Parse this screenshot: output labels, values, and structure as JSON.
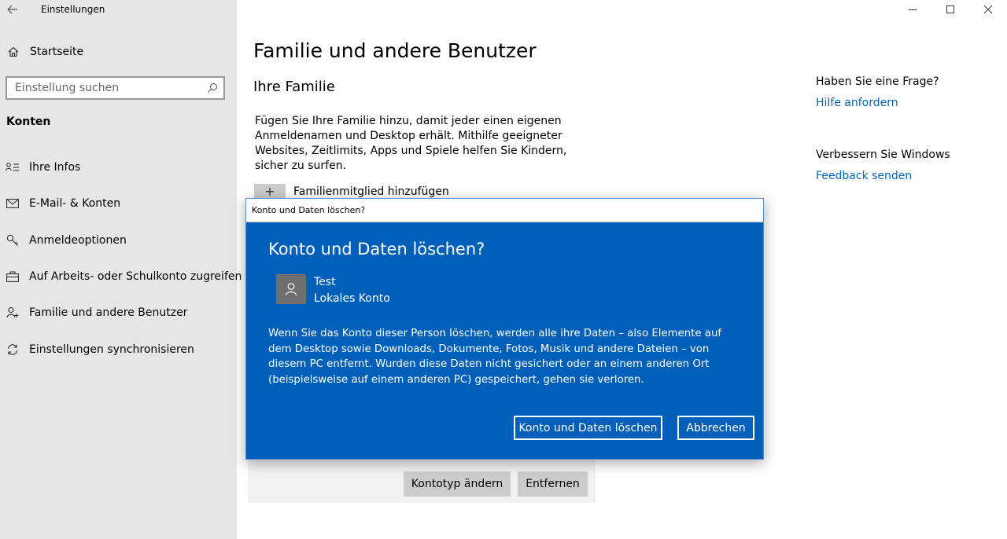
{
  "app": {
    "title": "Einstellungen"
  },
  "sidebar": {
    "home_label": "Startseite",
    "search_placeholder": "Einstellung suchen",
    "section_label": "Konten",
    "items": [
      {
        "label": "Ihre Infos",
        "icon": "person-card-icon"
      },
      {
        "label": "E-Mail- & Konten",
        "icon": "mail-icon"
      },
      {
        "label": "Anmeldeoptionen",
        "icon": "key-icon"
      },
      {
        "label": "Auf Arbeits- oder Schulkonto zugreifen",
        "icon": "briefcase-icon"
      },
      {
        "label": "Familie und andere Benutzer",
        "icon": "person-add-icon"
      },
      {
        "label": "Einstellungen synchronisieren",
        "icon": "sync-icon"
      }
    ]
  },
  "main": {
    "page_title": "Familie und andere Benutzer",
    "family_heading": "Ihre Familie",
    "family_description": "Fügen Sie Ihre Familie hinzu, damit jeder einen eigenen Anmeldenamen und Desktop erhält. Mithilfe geeigneter Websites, Zeitlimits, Apps und Spiele helfen Sie Kindern, sicher zu surfen.",
    "add_family_label": "Familienmitglied hinzufügen",
    "change_type_button": "Kontotyp ändern",
    "remove_button": "Entfernen"
  },
  "help": {
    "question": "Haben Sie eine Frage?",
    "help_link": "Hilfe anfordern",
    "improve_title": "Verbessern Sie Windows",
    "feedback_link": "Feedback senden"
  },
  "dialog": {
    "titlebar": "Konto und Daten löschen?",
    "heading": "Konto und Daten löschen?",
    "user_name": "Test",
    "user_type": "Lokales Konto",
    "message": "Wenn Sie das Konto dieser Person löschen, werden alle ihre Daten – also Elemente auf dem Desktop sowie Downloads, Dokumente, Fotos, Musik und andere Dateien – von diesem PC entfernt. Wurden diese Daten nicht gesichert oder an einem anderen Ort (beispielsweise auf einem anderen PC) gespeichert, gehen sie verloren.",
    "delete_button": "Konto und Daten löschen",
    "cancel_button": "Abbrechen"
  },
  "colors": {
    "sidebar_bg": "#e6e6e6",
    "dialog_bg": "#005fb8",
    "link": "#0067c0",
    "button_gray": "#cccccc"
  }
}
